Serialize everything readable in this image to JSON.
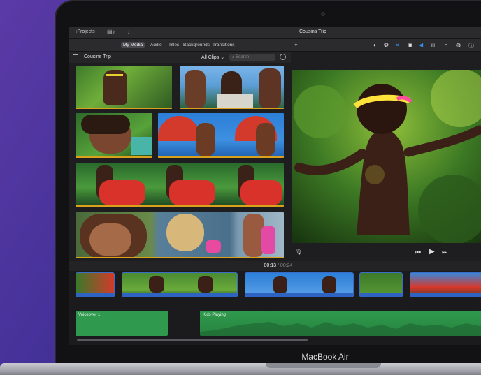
{
  "app": {
    "projects_label": "Projects",
    "project_title": "Cousins Trip"
  },
  "tabs": [
    {
      "label": "My Media"
    },
    {
      "label": "Audio"
    },
    {
      "label": "Titles"
    },
    {
      "label": "Backgrounds"
    },
    {
      "label": "Transitions"
    }
  ],
  "library": {
    "title": "Cousins Trip",
    "filter": "All Clips",
    "search_placeholder": "Search"
  },
  "timecode": {
    "current": "00:13",
    "separator": "/",
    "total": "00:24"
  },
  "timeline": {
    "voiceover_label": "Voiceover 1",
    "music_label": "Kids Playing"
  },
  "device": {
    "label": "MacBook Air"
  },
  "colors": {
    "accent": "#3b8cf0",
    "clip_bar": "#d9a11c",
    "audio_green": "#2f9a4d"
  }
}
